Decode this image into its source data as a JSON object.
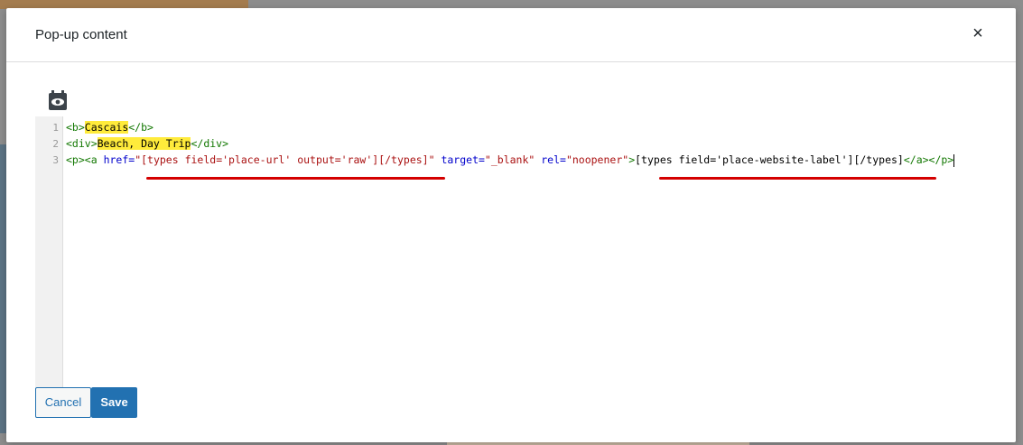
{
  "modal": {
    "title": "Pop-up content",
    "close_label": "×"
  },
  "toolbar": {
    "preview_icon": "eye-icon"
  },
  "editor": {
    "line_numbers": [
      "1",
      "2",
      "3"
    ],
    "lines": [
      {
        "open_tag": "<b>",
        "text": "Cascais",
        "close_tag": "</b>"
      },
      {
        "open_tag": "<div>",
        "text": "Beach, Day Trip",
        "close_tag": "</div>"
      },
      {
        "p_open": "<p>",
        "a_open": "<a",
        "href_attr": " href=",
        "href_value": "\"[types field='place-url' output='raw'][/types]\"",
        "target_attr": " target=",
        "target_value": "\"_blank\"",
        "rel_attr": " rel=",
        "rel_value": "\"noopener\"",
        "a_gt": ">",
        "link_text": "[types field='place-website-label'][/types]",
        "close_tags": "</a></p>"
      }
    ],
    "highlight_color": "#ffeb3b",
    "annotation_color": "#d40000"
  },
  "buttons": {
    "cancel": "Cancel",
    "save": "Save"
  },
  "colors": {
    "accent": "#2271b1",
    "tag": "#117700",
    "attribute": "#0000cc",
    "string": "#aa1111"
  }
}
